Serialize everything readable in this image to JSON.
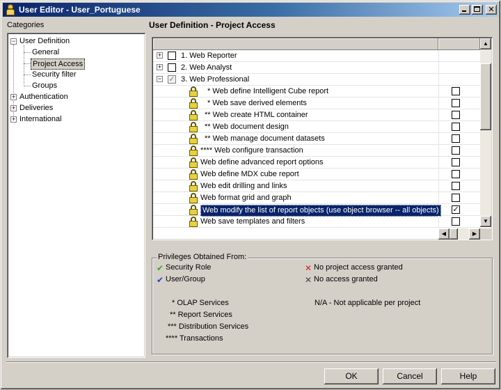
{
  "window": {
    "title": "User Editor - User_Portuguese",
    "minimize_glyph": "_",
    "close_glyph": "✕"
  },
  "categories": {
    "label": "Categories",
    "tree": [
      {
        "label": "User Definition",
        "expander": "−"
      },
      {
        "label": "General"
      },
      {
        "label": "Project Access",
        "selected": true
      },
      {
        "label": "Security filter"
      },
      {
        "label": "Groups"
      },
      {
        "label": "Authentication",
        "expander": "+"
      },
      {
        "label": "Deliveries",
        "expander": "+"
      },
      {
        "label": "International",
        "expander": "+"
      }
    ]
  },
  "main": {
    "heading": "User Definition - Project Access",
    "privileges": [
      {
        "label": "1. Web Reporter",
        "expander": "+",
        "checked": false
      },
      {
        "label": "2. Web Analyst",
        "expander": "+",
        "checked": false
      },
      {
        "label": "3. Web Professional",
        "expander": "−",
        "checked": "partial",
        "check_glyph": "✓"
      },
      {
        "label": "* Web define Intelligent Cube report",
        "checked": false
      },
      {
        "label": "* Web save derived elements",
        "checked": false
      },
      {
        "label": "** Web create HTML container",
        "checked": false
      },
      {
        "label": "** Web document design",
        "checked": false
      },
      {
        "label": "** Web manage document datasets",
        "checked": false
      },
      {
        "label": "**** Web configure transaction",
        "checked": false
      },
      {
        "label": "Web define advanced report options",
        "checked": false
      },
      {
        "label": "Web define MDX cube report",
        "checked": false
      },
      {
        "label": "Web edit drilling and links",
        "checked": false
      },
      {
        "label": "Web format grid and graph",
        "checked": false
      },
      {
        "label": "Web modify the list of report objects (use object browser -- all objects)",
        "checked": true,
        "selected": true,
        "check_glyph": "✓"
      },
      {
        "label": "Web save templates and filters",
        "checked": false
      },
      {
        "label": "",
        "checked": false
      }
    ],
    "scroll_up_glyph": "▲",
    "scroll_down_glyph": "▼",
    "scroll_left_glyph": "◀",
    "scroll_right_glyph": "▶"
  },
  "privileges_obtained": {
    "title": "Privileges Obtained From:",
    "security_role": "Security Role",
    "user_group": "User/Group",
    "no_project_access": "No project access granted",
    "no_access": "No access granted",
    "na": "N/A - Not applicable per project",
    "legend": [
      "* OLAP Services",
      "** Report Services",
      "*** Distribution Services",
      "**** Transactions"
    ],
    "icons": {
      "security_role_glyph": "✔",
      "user_group_glyph": "✔",
      "no_project_glyph": "✕",
      "no_access_glyph": "✕"
    },
    "colors": {
      "security_role": "#3aa03a",
      "user_group": "#2040c0",
      "no_project": "#d02020",
      "no_access": "#404040"
    }
  },
  "buttons": {
    "ok": "OK",
    "cancel": "Cancel",
    "help": "Help"
  }
}
